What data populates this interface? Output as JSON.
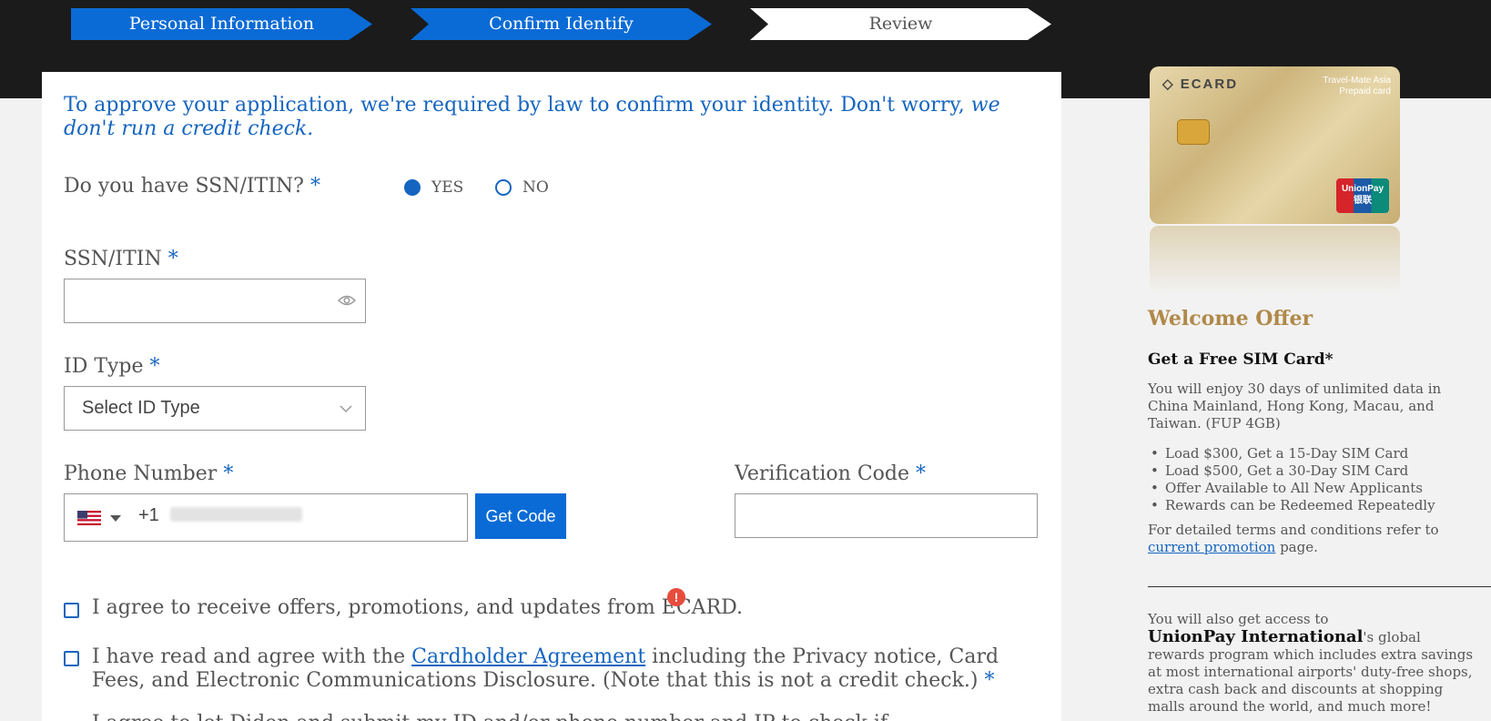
{
  "steps": [
    {
      "label": "Personal Information",
      "state": "done"
    },
    {
      "label": "Confirm Identify",
      "state": "active"
    },
    {
      "label": "Review",
      "state": "pending"
    }
  ],
  "intro": {
    "text": "To approve your application, we're required by law to confirm your identity. Don't worry, ",
    "emphasis": "we don't run a credit check."
  },
  "ssn_question": {
    "label": "Do you have SSN/ITIN?",
    "required_mark": "*",
    "options": [
      "YES",
      "NO"
    ],
    "selected": "YES"
  },
  "ssn_field": {
    "label": "SSN/ITIN",
    "required_mark": "*",
    "value": ""
  },
  "id_type": {
    "label": "ID Type",
    "required_mark": "*",
    "selected": "Select ID Type"
  },
  "phone": {
    "label": "Phone Number",
    "required_mark": "*",
    "country_code": "+1",
    "get_code_label": "Get Code"
  },
  "verification": {
    "label": "Verification Code",
    "required_mark": "*",
    "value": ""
  },
  "checkboxes": {
    "offers": "I agree to receive offers, promotions, and updates from ECARD.",
    "agreement_pre": "I have read and agree with the ",
    "agreement_link": "Cardholder Agreement",
    "agreement_post": " including the Privacy notice, Card Fees, and Electronic Communications Disclosure. (Note that this is not a credit check.) ",
    "agreement_req": "*",
    "cut_off": "I agree to let Didon and submit my ID and/or phone number and IP to check if..."
  },
  "alert_icon": "!",
  "card": {
    "brand": "ECARD",
    "series_line1": "Travel-Mate Asia",
    "series_line2": "Prepaid card",
    "network_line1": "UnionPay",
    "network_line2": "银联"
  },
  "sidebar": {
    "offer_title": "Welcome Offer",
    "offer_subtitle": "Get a Free SIM Card*",
    "offer_desc": "You will enjoy 30 days of unlimited data in China Mainland, Hong Kong, Macau, and Taiwan. (FUP 4GB)",
    "bullets": [
      "Load $300, Get a 15-Day SIM Card",
      "Load $500, Get a 30-Day SIM Card",
      "Offer Available to All New Applicants",
      "Rewards can be Redeemed Repeatedly"
    ],
    "terms_pre": "For detailed terms and conditions refer to ",
    "terms_link": "current promotion",
    "terms_post": " page.",
    "access_pre": "You will also get access to",
    "access_brand": "UnionPay International",
    "access_post": "'s global rewards program which includes extra savings at most international airports' duty-free shops, extra cash back and discounts at shopping malls around the world, and much more!"
  },
  "colors": {
    "accent": "#1565c0",
    "button": "#0a6bd6",
    "gold": "#b0894a",
    "alert": "#e74c3c"
  }
}
